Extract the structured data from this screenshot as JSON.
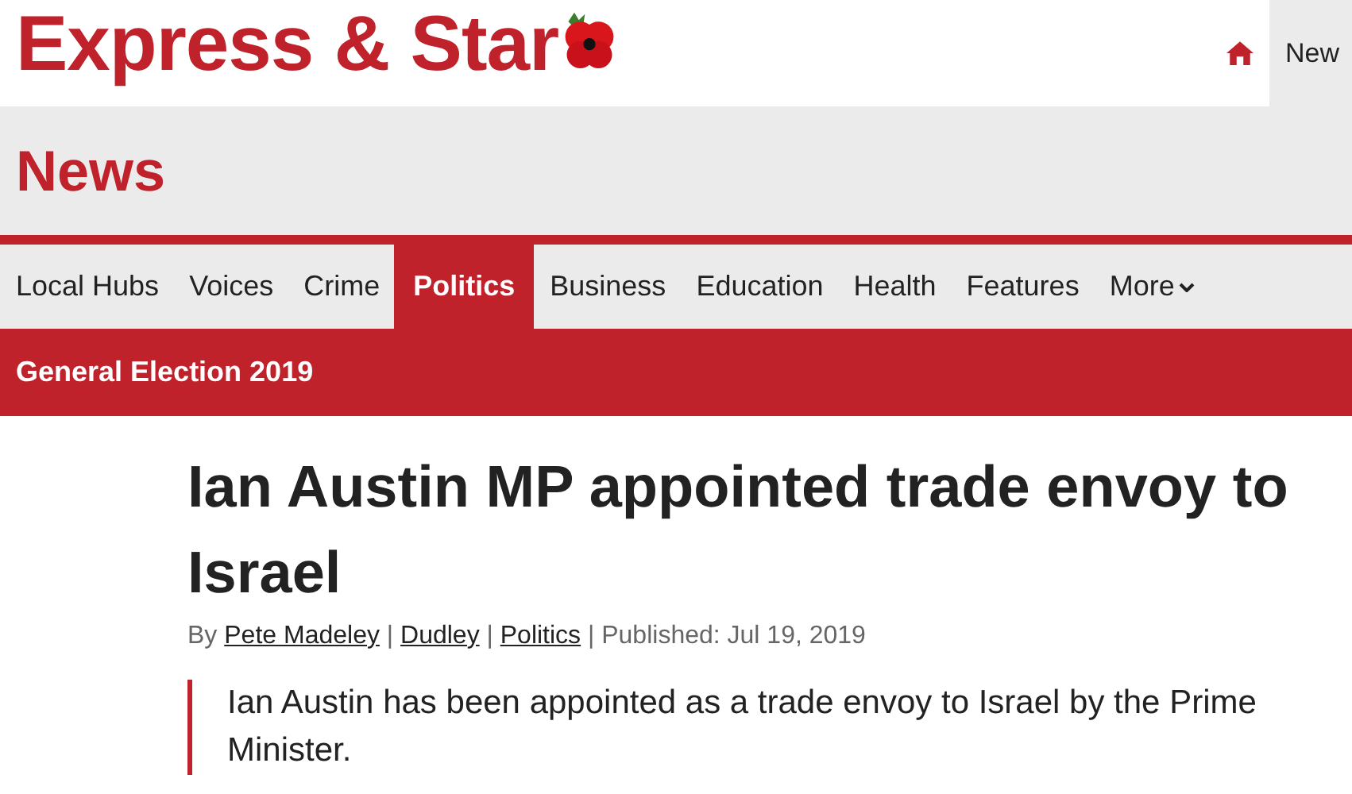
{
  "header": {
    "logo": "Express & Star",
    "top_tab": {
      "label": "New",
      "selected": true
    }
  },
  "section": {
    "title": "News"
  },
  "nav": [
    {
      "label": "Local Hubs",
      "selected": false
    },
    {
      "label": "Voices",
      "selected": false
    },
    {
      "label": "Crime",
      "selected": false
    },
    {
      "label": "Politics",
      "selected": true
    },
    {
      "label": "Business",
      "selected": false
    },
    {
      "label": "Education",
      "selected": false
    },
    {
      "label": "Health",
      "selected": false
    },
    {
      "label": "Features",
      "selected": false
    },
    {
      "label": "More",
      "selected": false
    }
  ],
  "banner": "General Election 2019",
  "article": {
    "headline": "Ian Austin MP appointed trade envoy to Israel",
    "byline": {
      "prefix": "By",
      "links": [
        "Pete Madeley",
        "Dudley",
        "Politics"
      ],
      "separator": "|",
      "published": "Published: Jul 19, 2019"
    },
    "lead": "Ian Austin has been appointed as a trade envoy to Israel by the Prime Minister."
  }
}
